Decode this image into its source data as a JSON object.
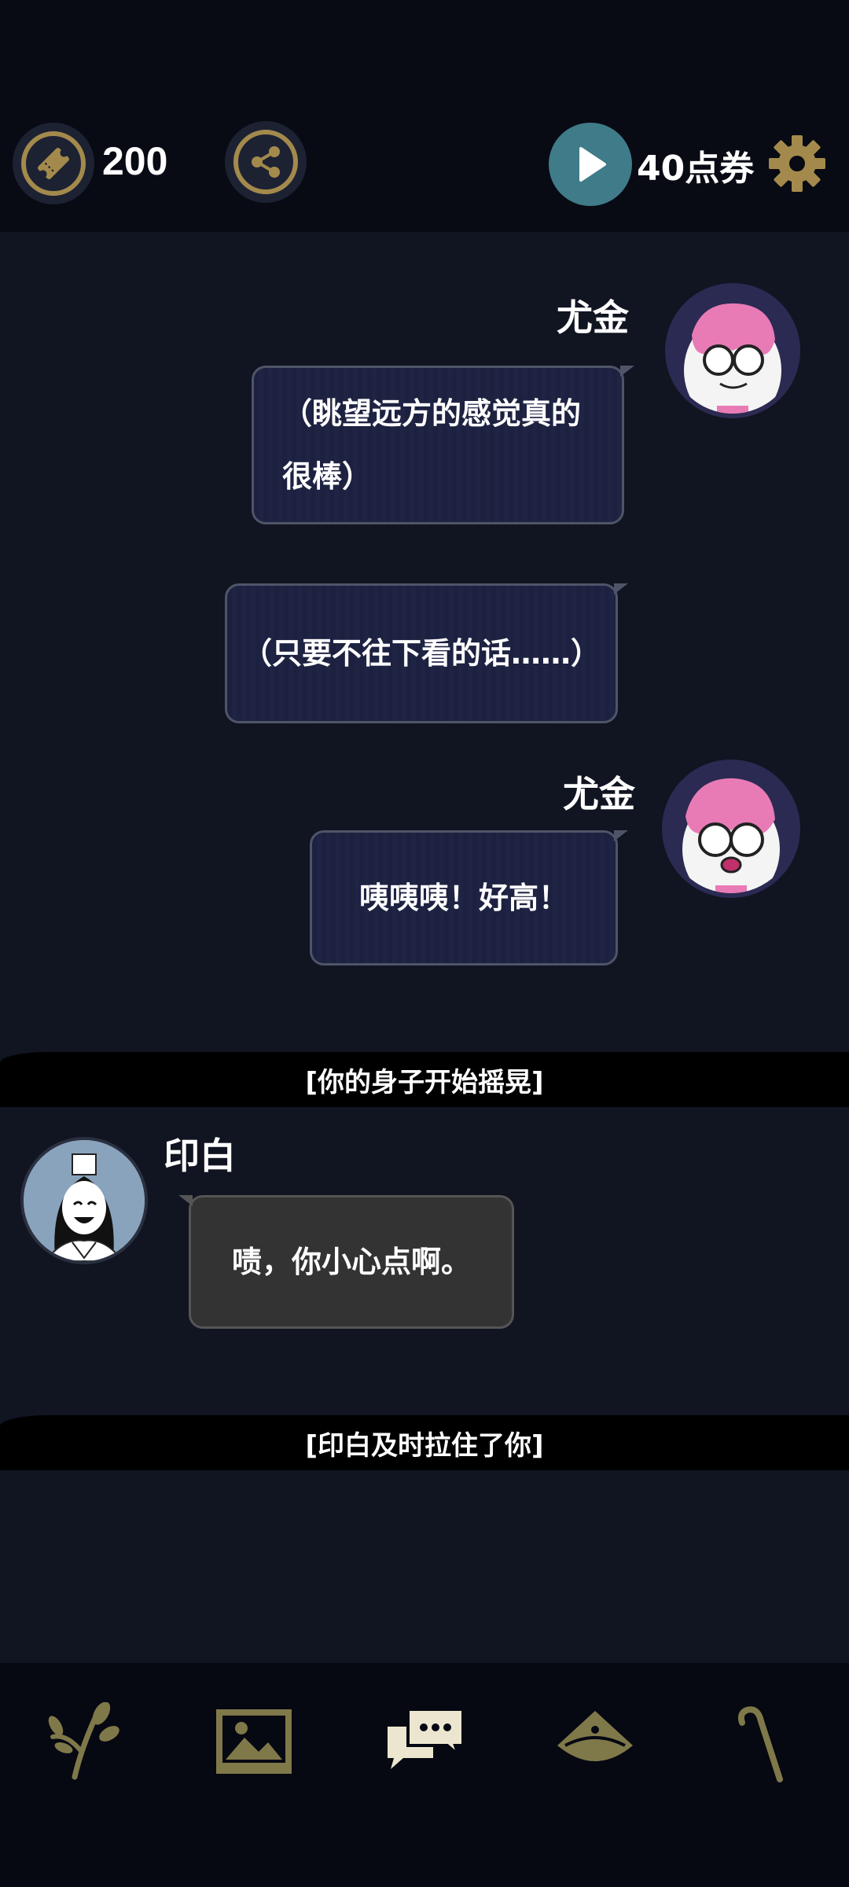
{
  "topbar": {
    "ticket_count": "200",
    "vouchers_label": "40点券",
    "icons": {
      "ticket": "ticket-icon",
      "share": "share-icon",
      "play": "play-icon",
      "settings": "gear-icon"
    }
  },
  "chat": {
    "messages": [
      {
        "speaker": "尤金",
        "lines": [
          "（眺望远方的感觉真的",
          "很棒）"
        ]
      },
      {
        "speaker": "",
        "lines": [
          "（只要不往下看的话……）"
        ]
      },
      {
        "speaker": "尤金",
        "lines": [
          "咦咦咦！好高！"
        ]
      },
      {
        "narration": "[你的身子开始摇晃]"
      },
      {
        "speaker": "印白",
        "lines": [
          "啧，你小心点啊。"
        ]
      },
      {
        "narration": "[印白及时拉住了你]"
      }
    ]
  },
  "bottom_nav": {
    "items": [
      "plant-icon",
      "gallery-icon",
      "chat-icon",
      "hat-icon",
      "cane-icon"
    ],
    "active": "chat-icon"
  },
  "colors": {
    "gold": "#a38a4c",
    "play": "#3f7b88",
    "bubble_dark": "#1c2140",
    "bubble_gray": "#333333"
  }
}
